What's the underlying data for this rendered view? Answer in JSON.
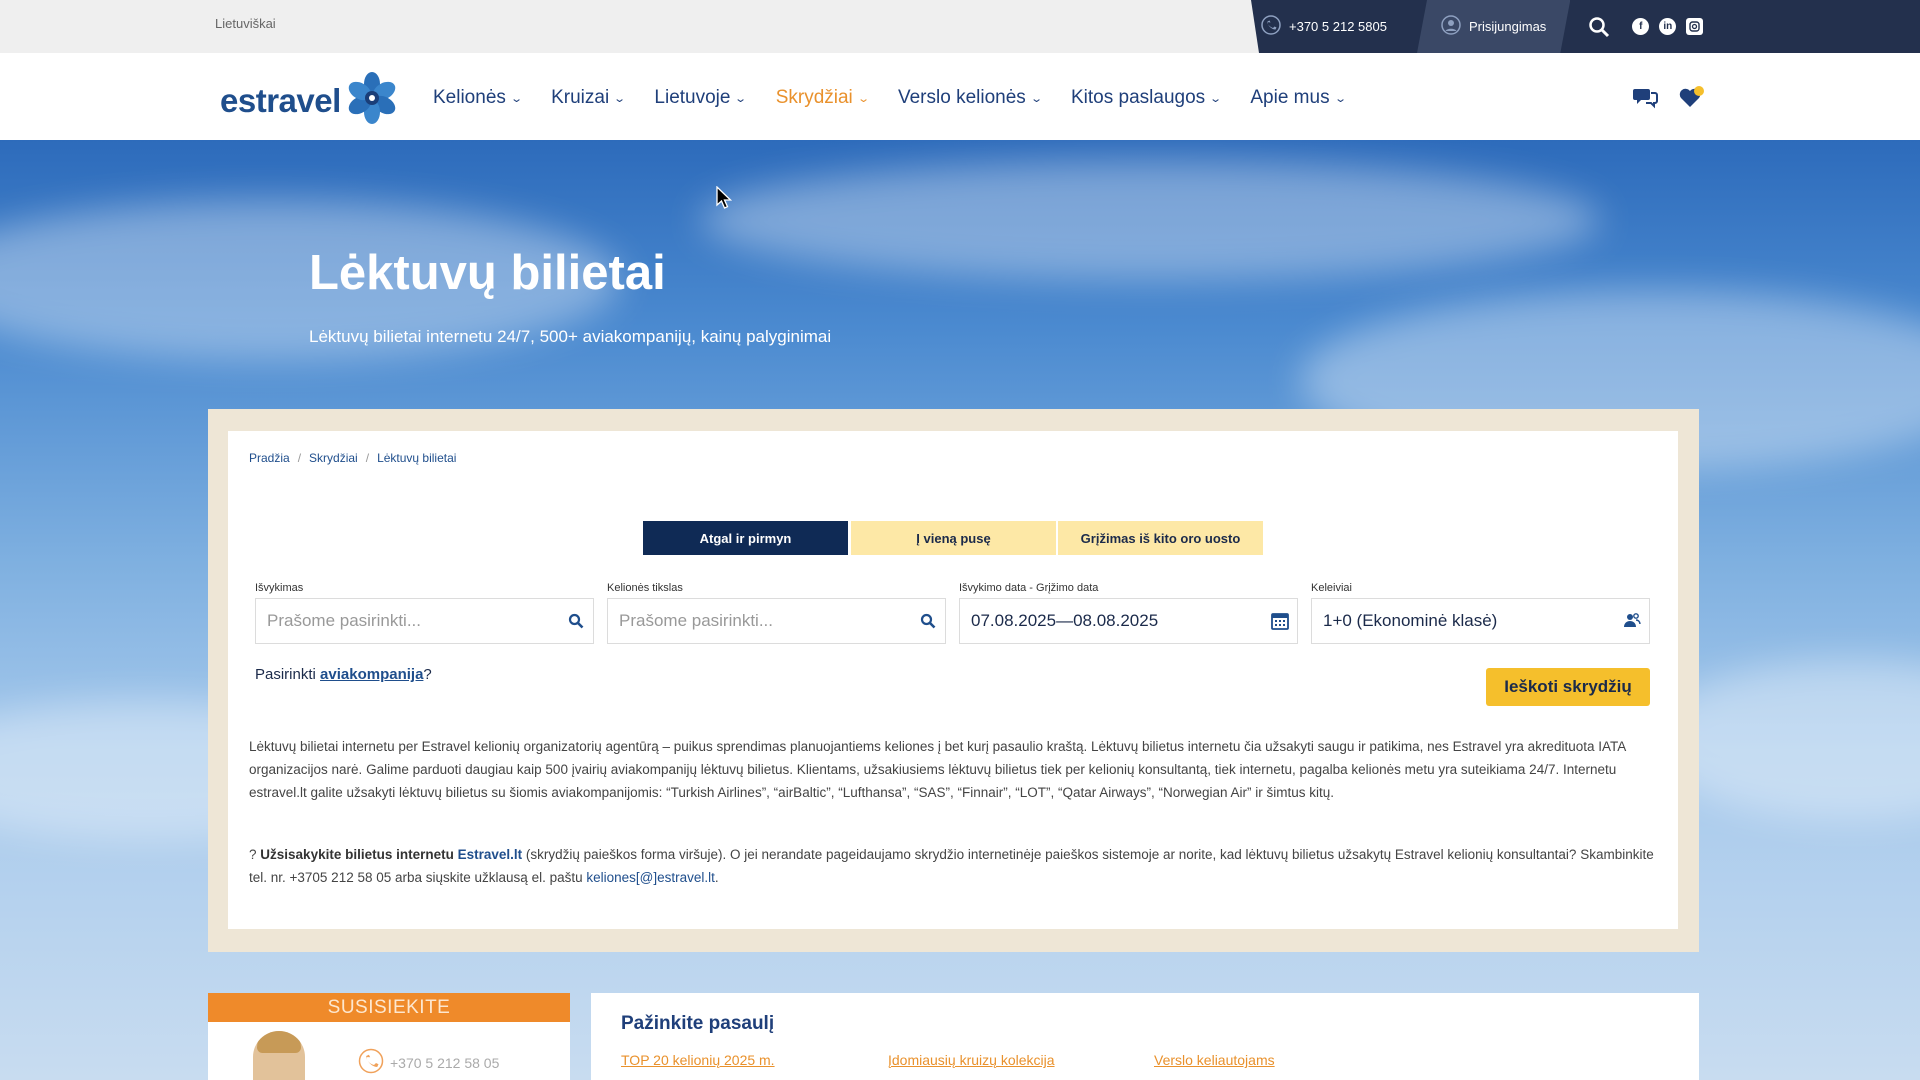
{
  "topbar": {
    "language": "Lietuviškai",
    "phone": "+370 5 212 5805",
    "login": "Prisijungimas"
  },
  "brand": {
    "name": "estravel"
  },
  "nav": {
    "items": [
      {
        "label": "Kelionės"
      },
      {
        "label": "Kruizai"
      },
      {
        "label": "Lietuvoje"
      },
      {
        "label": "Skrydžiai"
      },
      {
        "label": "Verslo kelionės"
      },
      {
        "label": "Kitos paslaugos"
      },
      {
        "label": "Apie mus"
      }
    ],
    "active": "Skrydžiai"
  },
  "hero": {
    "title": "Lėktuvų bilietai",
    "subtitle": "Lėktuvų bilietai internetu 24/7, 500+ aviakompanijų, kainų palyginimai"
  },
  "breadcrumb": [
    "Pradžia",
    "Skrydžiai",
    "Lėktuvų bilietai"
  ],
  "search": {
    "tabs": [
      {
        "label": "Atgal ir pirmyn",
        "active": true
      },
      {
        "label": "Į vieną pusę",
        "active": false
      },
      {
        "label": "Grįžimas iš kito oro uosto",
        "active": false
      }
    ],
    "departure": {
      "label": "Išvykimas",
      "placeholder": "Prašome pasirinkti..."
    },
    "destination": {
      "label": "Kelionės tikslas",
      "placeholder": "Prašome pasirinkti..."
    },
    "dates": {
      "label": "Išvykimo data - Grįžimo data",
      "value": "07.08.2025—08.08.2025"
    },
    "passengers": {
      "label": "Keleiviai",
      "value": "1+0 (Ekonominė klasė)"
    },
    "airline_prefix": "Pasirinkti",
    "airline_link": "aviakompanija",
    "airline_suffix": "?",
    "button": "Ieškoti skrydžių"
  },
  "content": {
    "paragraph1": "Lėktuvų bilietai internetu per Estravel kelionių organizatorių agentūrą – puikus sprendimas planuojantiems keliones į bet kurį pasaulio kraštą. Lėktuvų bilietus internetu čia užsakyti saugu ir patikima, nes Estravel yra akredituota IATA organizacijos narė. Galime parduoti daugiau kaip 500 įvairių aviakompanijų lėktuvų bilietus. Klientams, užsakiusiems lėktuvų bilietus tiek per kelionių konsultantą, tiek internetu, pagalba kelionės metu yra suteikiama 24/7. Internetu estravel.lt galite užsakyti lėktuvų bilietus su šiomis aviakompanijomis: “Turkish Airlines”, “airBaltic”, “Lufthansa”, “SAS”, “Finnair”, “LOT”, “Qatar Airways”, “Norwegian Air” ir šimtus kitų.",
    "p2_prefix": "?",
    "p2_bold": "Užsisakykite bilietus internetu",
    "p2_link": "Estravel.lt",
    "p2_text": "(skrydžių paieškos forma viršuje). O jei nerandate pageidaujamo skrydžio internetinėje paieškos sistemoje ar norite, kad lėktuvų bilietus užsakytų Estravel kelionių konsultantai? Skambinkite tel. nr. +3705 212 58 05 arba siųskite užklausą el. paštu",
    "p2_email": "keliones[@]estravel.lt",
    "p2_end": "."
  },
  "contact": {
    "heading": "SUSISIEKITE",
    "phone": "+370 5 212 58 05"
  },
  "explore": {
    "title": "Pažinkite pasaulį",
    "links": [
      "TOP 20 kelionių 2025 m.",
      "Įdomiausių kruizų kolekcija",
      "Verslo keliautojams"
    ]
  }
}
